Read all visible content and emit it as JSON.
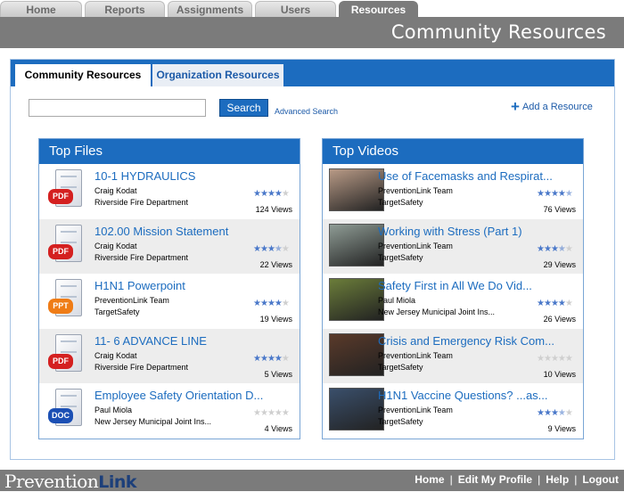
{
  "top_tabs": [
    {
      "label": "Home"
    },
    {
      "label": "Reports"
    },
    {
      "label": "Assignments"
    },
    {
      "label": "Users"
    },
    {
      "label": "Resources",
      "active": true
    }
  ],
  "header": {
    "title": "Community Resources"
  },
  "panel_tabs": [
    {
      "label": "Community Resources",
      "active": true
    },
    {
      "label": "Organization Resources",
      "active": false
    }
  ],
  "search": {
    "value": "",
    "placeholder": "",
    "button_label": "Search",
    "advanced_label": "Advanced Search"
  },
  "add_resource_label": "Add a Resource",
  "top_files": {
    "title": "Top Files",
    "items": [
      {
        "title": "10-1 HYDRAULICS",
        "author": "Craig Kodat",
        "org": "Riverside Fire Department",
        "rating": 4,
        "views": "124 Views",
        "type": "PDF"
      },
      {
        "title": "102.00 Mission Statement",
        "author": "Craig Kodat",
        "org": "Riverside Fire Department",
        "rating": 3.5,
        "views": "22 Views",
        "type": "PDF"
      },
      {
        "title": "H1N1 Powerpoint",
        "author": "PreventionLink Team",
        "org": "TargetSafety",
        "rating": 4,
        "views": "19 Views",
        "type": "PPT"
      },
      {
        "title": "11- 6 ADVANCE LINE",
        "author": "Craig Kodat",
        "org": "Riverside Fire Department",
        "rating": 4,
        "views": "5 Views",
        "type": "PDF"
      },
      {
        "title": "Employee Safety Orientation D...",
        "author": "Paul Miola",
        "org": "New Jersey Municipal Joint Ins...",
        "rating": 0,
        "views": "4 Views",
        "type": "DOC"
      }
    ]
  },
  "top_videos": {
    "title": "Top Videos",
    "items": [
      {
        "title": "Use of Facemasks and Respirat...",
        "author": "PreventionLink Team",
        "org": "TargetSafety",
        "rating": 4.5,
        "views": "76 Views",
        "thumb_color": "#b89a86"
      },
      {
        "title": "Working with Stress (Part 1)",
        "author": "PreventionLink Team",
        "org": "TargetSafety",
        "rating": 3.5,
        "views": "29 Views",
        "thumb_color": "#8f9c95"
      },
      {
        "title": "Safety First in All We Do Vid...",
        "author": "Paul Miola",
        "org": "New Jersey Municipal Joint Ins...",
        "rating": 4,
        "views": "26 Views",
        "thumb_color": "#6b7d3a"
      },
      {
        "title": "Crisis and Emergency Risk Com...",
        "author": "PreventionLink Team",
        "org": "TargetSafety",
        "rating": 0,
        "views": "10 Views",
        "thumb_color": "#5a3a2a"
      },
      {
        "title": "H1N1 Vaccine Questions? ...as...",
        "author": "PreventionLink Team",
        "org": "TargetSafety",
        "rating": 3.5,
        "views": "9 Views",
        "thumb_color": "#3a4f6b"
      }
    ]
  },
  "footer": {
    "logo_part1": "Prevention",
    "logo_part2": "Link",
    "nav": [
      "Home",
      "Edit My Profile",
      "Help",
      "Logout"
    ]
  }
}
